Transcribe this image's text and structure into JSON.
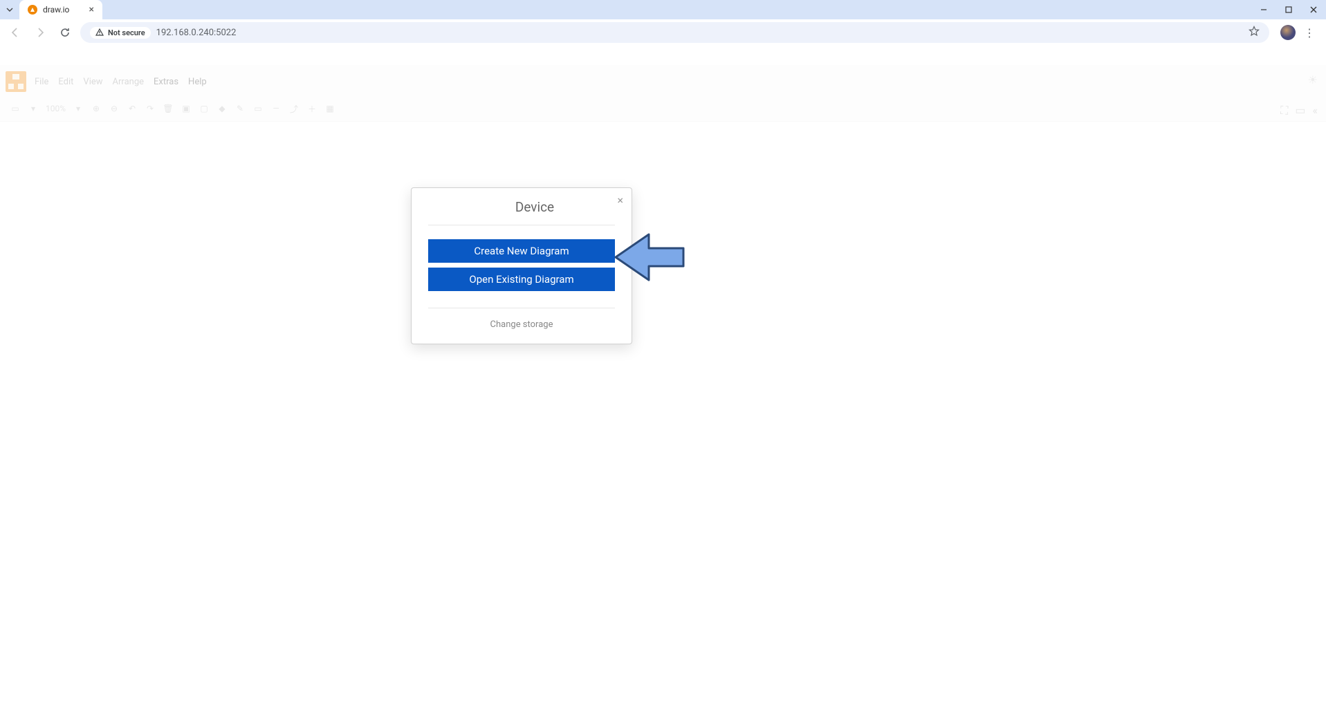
{
  "browser": {
    "tab_title": "draw.io",
    "not_secure_label": "Not secure",
    "url": "192.168.0.240:5022"
  },
  "app": {
    "menu": {
      "file": "File",
      "edit": "Edit",
      "view": "View",
      "arrange": "Arrange",
      "extras": "Extras",
      "help": "Help"
    },
    "zoom_label": "100%"
  },
  "dialog": {
    "title": "Device",
    "create_label": "Create New Diagram",
    "open_label": "Open Existing Diagram",
    "change_storage_label": "Change storage"
  }
}
